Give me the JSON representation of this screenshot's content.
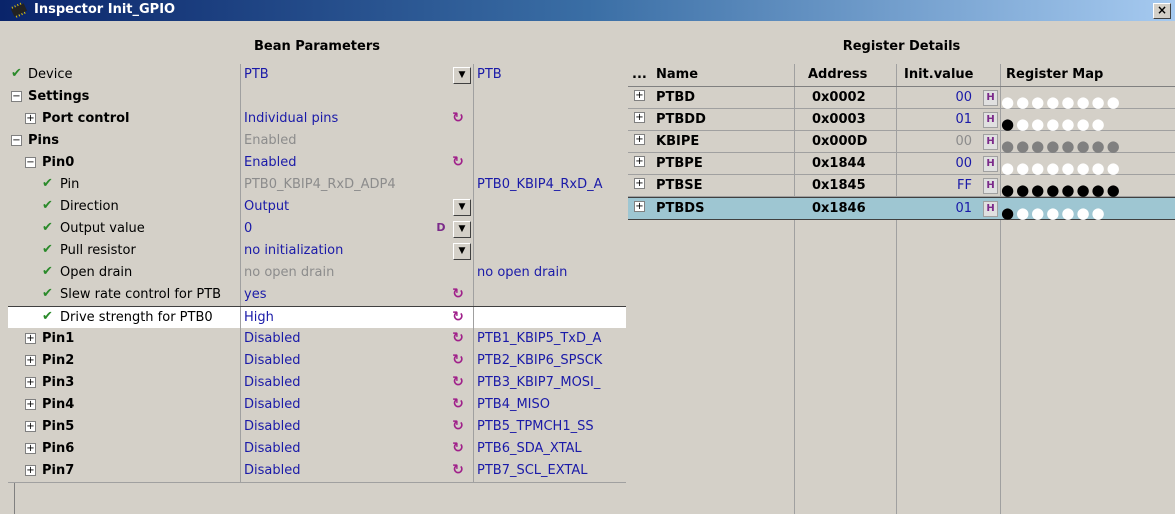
{
  "window": {
    "title": "Inspector Init_GPIO",
    "close_label": "×"
  },
  "bean_parameters": {
    "header": "Bean Parameters",
    "rows": [
      {
        "label": "Device",
        "value": "PTB",
        "extra": "PTB"
      },
      {
        "label": "Settings",
        "value": "",
        "extra": ""
      },
      {
        "label": "Port control",
        "value": "Individual pins",
        "extra": ""
      },
      {
        "label": "Pins",
        "value": "Enabled",
        "extra": ""
      },
      {
        "label": "Pin0",
        "value": "Enabled",
        "extra": ""
      },
      {
        "label": "Pin",
        "value": "PTB0_KBIP4_RxD_ADP4",
        "extra": "PTB0_KBIP4_RxD_A"
      },
      {
        "label": "Direction",
        "value": "Output",
        "extra": ""
      },
      {
        "label": "Output value",
        "value": "0",
        "extra": ""
      },
      {
        "label": "Pull resistor",
        "value": "no initialization",
        "extra": ""
      },
      {
        "label": "Open drain",
        "value": "no open drain",
        "extra": "no open drain"
      },
      {
        "label": "Slew rate control for PTB",
        "value": "yes",
        "extra": ""
      },
      {
        "label": "Drive strength for PTB0",
        "value": "High",
        "extra": ""
      },
      {
        "label": "Pin1",
        "value": "Disabled",
        "extra": "PTB1_KBIP5_TxD_A"
      },
      {
        "label": "Pin2",
        "value": "Disabled",
        "extra": "PTB2_KBIP6_SPSCK"
      },
      {
        "label": "Pin3",
        "value": "Disabled",
        "extra": "PTB3_KBIP7_MOSI_"
      },
      {
        "label": "Pin4",
        "value": "Disabled",
        "extra": "PTB4_MISO"
      },
      {
        "label": "Pin5",
        "value": "Disabled",
        "extra": "PTB5_TPMCH1_SS"
      },
      {
        "label": "Pin6",
        "value": "Disabled",
        "extra": "PTB6_SDA_XTAL"
      },
      {
        "label": "Pin7",
        "value": "Disabled",
        "extra": "PTB7_SCL_EXTAL"
      }
    ]
  },
  "register_details": {
    "header": "Register Details",
    "columns": {
      "dots": "...",
      "name": "Name",
      "address": "Address",
      "init": "Init.value",
      "map": "Register Map"
    },
    "rows": [
      {
        "name": "PTBD",
        "address": "0x0002",
        "init": "00",
        "h": "H"
      },
      {
        "name": "PTBDD",
        "address": "0x0003",
        "init": "01",
        "h": "H"
      },
      {
        "name": "KBIPE",
        "address": "0x000D",
        "init": "00",
        "h": "H"
      },
      {
        "name": "PTBPE",
        "address": "0x1844",
        "init": "00",
        "h": "H"
      },
      {
        "name": "PTBSE",
        "address": "0x1845",
        "init": "FF",
        "h": "H"
      },
      {
        "name": "PTBDS",
        "address": "0x1846",
        "init": "01",
        "h": "H"
      }
    ]
  },
  "icons": {
    "expand": "+",
    "collapse": "−",
    "check": "✔",
    "reset": "↻",
    "dropdown": "▼",
    "d_button": "D"
  }
}
